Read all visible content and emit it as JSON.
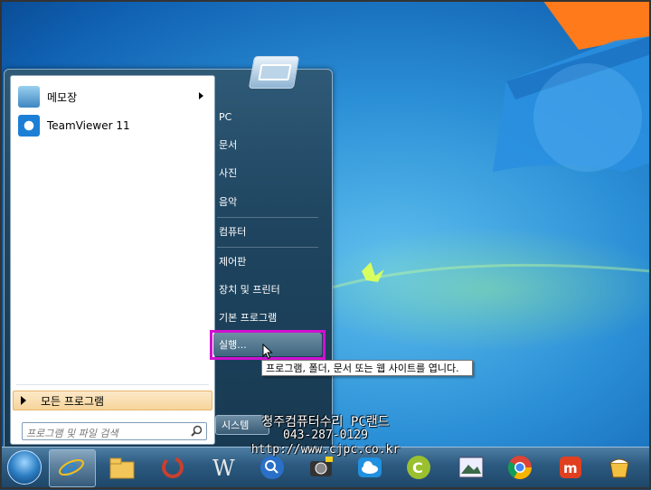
{
  "start_menu": {
    "pinned": [
      {
        "label": "메모장",
        "icon": "notepad-icon",
        "has_submenu": true
      },
      {
        "label": "TeamViewer 11",
        "icon": "teamviewer-icon",
        "has_submenu": false
      }
    ],
    "all_programs": "모든 프로그램",
    "search_placeholder": "프로그램 및 파일 검색",
    "right_items": [
      "PC",
      "문서",
      "사진",
      "음악",
      "컴퓨터",
      "제어판",
      "장치 및 프린터",
      "기본 프로그램",
      "실행..."
    ],
    "shutdown_label": "시스템"
  },
  "tooltip": "프로그램, 폴더, 문서 또는 웹 사이트를 엽니다.",
  "watermark": {
    "line1": "청주컴퓨터수리 PC랜드",
    "line2": "043-287-0129",
    "line3": "http://www.cjpc.co.kr"
  },
  "taskbar": {
    "icons": [
      "start-orb-icon",
      "internet-explorer-icon",
      "file-explorer-icon",
      "sync-icon",
      "wordpad-icon",
      "search-app-icon",
      "camera-icon",
      "cloud-icon",
      "c-app-icon",
      "photo-app-icon",
      "chrome-icon",
      "m-app-icon",
      "cup-icon"
    ]
  },
  "colors": {
    "highlight_box": "#d010d0",
    "all_programs_bg": "#f7d49a"
  }
}
